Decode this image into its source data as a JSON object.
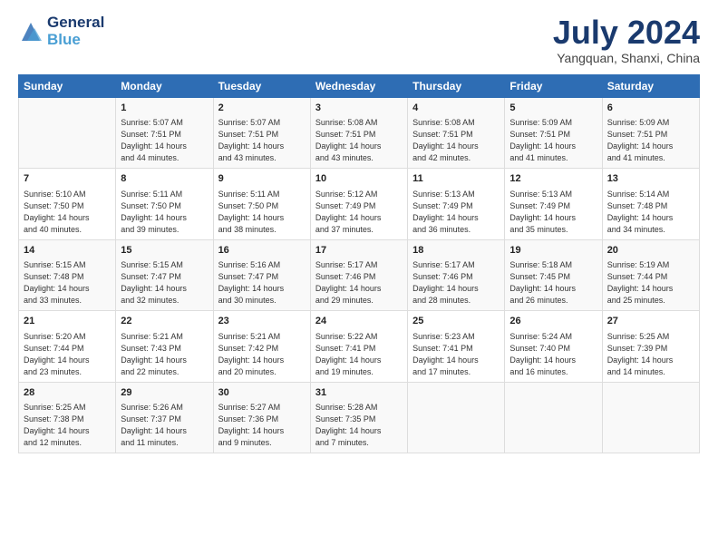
{
  "header": {
    "logo_line1": "General",
    "logo_line2": "Blue",
    "month_title": "July 2024",
    "location": "Yangquan, Shanxi, China"
  },
  "days_of_week": [
    "Sunday",
    "Monday",
    "Tuesday",
    "Wednesday",
    "Thursday",
    "Friday",
    "Saturday"
  ],
  "weeks": [
    [
      {
        "date": "",
        "info": ""
      },
      {
        "date": "1",
        "info": "Sunrise: 5:07 AM\nSunset: 7:51 PM\nDaylight: 14 hours\nand 44 minutes."
      },
      {
        "date": "2",
        "info": "Sunrise: 5:07 AM\nSunset: 7:51 PM\nDaylight: 14 hours\nand 43 minutes."
      },
      {
        "date": "3",
        "info": "Sunrise: 5:08 AM\nSunset: 7:51 PM\nDaylight: 14 hours\nand 43 minutes."
      },
      {
        "date": "4",
        "info": "Sunrise: 5:08 AM\nSunset: 7:51 PM\nDaylight: 14 hours\nand 42 minutes."
      },
      {
        "date": "5",
        "info": "Sunrise: 5:09 AM\nSunset: 7:51 PM\nDaylight: 14 hours\nand 41 minutes."
      },
      {
        "date": "6",
        "info": "Sunrise: 5:09 AM\nSunset: 7:51 PM\nDaylight: 14 hours\nand 41 minutes."
      }
    ],
    [
      {
        "date": "7",
        "info": "Sunrise: 5:10 AM\nSunset: 7:50 PM\nDaylight: 14 hours\nand 40 minutes."
      },
      {
        "date": "8",
        "info": "Sunrise: 5:11 AM\nSunset: 7:50 PM\nDaylight: 14 hours\nand 39 minutes."
      },
      {
        "date": "9",
        "info": "Sunrise: 5:11 AM\nSunset: 7:50 PM\nDaylight: 14 hours\nand 38 minutes."
      },
      {
        "date": "10",
        "info": "Sunrise: 5:12 AM\nSunset: 7:49 PM\nDaylight: 14 hours\nand 37 minutes."
      },
      {
        "date": "11",
        "info": "Sunrise: 5:13 AM\nSunset: 7:49 PM\nDaylight: 14 hours\nand 36 minutes."
      },
      {
        "date": "12",
        "info": "Sunrise: 5:13 AM\nSunset: 7:49 PM\nDaylight: 14 hours\nand 35 minutes."
      },
      {
        "date": "13",
        "info": "Sunrise: 5:14 AM\nSunset: 7:48 PM\nDaylight: 14 hours\nand 34 minutes."
      }
    ],
    [
      {
        "date": "14",
        "info": "Sunrise: 5:15 AM\nSunset: 7:48 PM\nDaylight: 14 hours\nand 33 minutes."
      },
      {
        "date": "15",
        "info": "Sunrise: 5:15 AM\nSunset: 7:47 PM\nDaylight: 14 hours\nand 32 minutes."
      },
      {
        "date": "16",
        "info": "Sunrise: 5:16 AM\nSunset: 7:47 PM\nDaylight: 14 hours\nand 30 minutes."
      },
      {
        "date": "17",
        "info": "Sunrise: 5:17 AM\nSunset: 7:46 PM\nDaylight: 14 hours\nand 29 minutes."
      },
      {
        "date": "18",
        "info": "Sunrise: 5:17 AM\nSunset: 7:46 PM\nDaylight: 14 hours\nand 28 minutes."
      },
      {
        "date": "19",
        "info": "Sunrise: 5:18 AM\nSunset: 7:45 PM\nDaylight: 14 hours\nand 26 minutes."
      },
      {
        "date": "20",
        "info": "Sunrise: 5:19 AM\nSunset: 7:44 PM\nDaylight: 14 hours\nand 25 minutes."
      }
    ],
    [
      {
        "date": "21",
        "info": "Sunrise: 5:20 AM\nSunset: 7:44 PM\nDaylight: 14 hours\nand 23 minutes."
      },
      {
        "date": "22",
        "info": "Sunrise: 5:21 AM\nSunset: 7:43 PM\nDaylight: 14 hours\nand 22 minutes."
      },
      {
        "date": "23",
        "info": "Sunrise: 5:21 AM\nSunset: 7:42 PM\nDaylight: 14 hours\nand 20 minutes."
      },
      {
        "date": "24",
        "info": "Sunrise: 5:22 AM\nSunset: 7:41 PM\nDaylight: 14 hours\nand 19 minutes."
      },
      {
        "date": "25",
        "info": "Sunrise: 5:23 AM\nSunset: 7:41 PM\nDaylight: 14 hours\nand 17 minutes."
      },
      {
        "date": "26",
        "info": "Sunrise: 5:24 AM\nSunset: 7:40 PM\nDaylight: 14 hours\nand 16 minutes."
      },
      {
        "date": "27",
        "info": "Sunrise: 5:25 AM\nSunset: 7:39 PM\nDaylight: 14 hours\nand 14 minutes."
      }
    ],
    [
      {
        "date": "28",
        "info": "Sunrise: 5:25 AM\nSunset: 7:38 PM\nDaylight: 14 hours\nand 12 minutes."
      },
      {
        "date": "29",
        "info": "Sunrise: 5:26 AM\nSunset: 7:37 PM\nDaylight: 14 hours\nand 11 minutes."
      },
      {
        "date": "30",
        "info": "Sunrise: 5:27 AM\nSunset: 7:36 PM\nDaylight: 14 hours\nand 9 minutes."
      },
      {
        "date": "31",
        "info": "Sunrise: 5:28 AM\nSunset: 7:35 PM\nDaylight: 14 hours\nand 7 minutes."
      },
      {
        "date": "",
        "info": ""
      },
      {
        "date": "",
        "info": ""
      },
      {
        "date": "",
        "info": ""
      }
    ]
  ]
}
